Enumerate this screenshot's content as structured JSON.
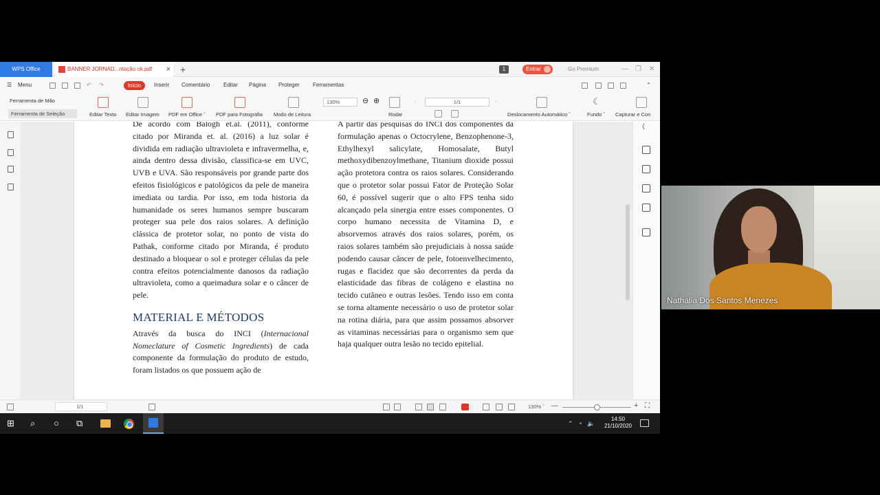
{
  "window": {
    "app_tab": "WPS Office",
    "doc_tab": "BANNER JORNAD...ntação ok.pdf",
    "tab_count": "1",
    "login": "Entrar",
    "premium": "Go Premium"
  },
  "menu": {
    "menu": "Menu",
    "items": [
      "Início",
      "Inserir",
      "Comentário",
      "Editar",
      "Página",
      "Proteger",
      "Ferramentas"
    ]
  },
  "ribbon": {
    "hand_tool": "Ferramenta de Mão",
    "select_tool": "Ferramenta de Seleção",
    "edit_text": "Editar Texto",
    "edit_image": "Editar Imagem",
    "pdf_office": "PDF em Office ˇ",
    "pdf_photo": "PDF para Fotografia",
    "read_mode": "Modo de Leitura",
    "zoom": "130%",
    "rotate": "Rodar",
    "page": "1/1",
    "auto_scroll": "Deslocamento Automático ˇ",
    "background": "Fundo ˇ",
    "capture": "Capturar e Con"
  },
  "document": {
    "left_para1": "De acordo com Balogh et.al. (2011), conforme citado por Miranda et. al. (2016) a luz solar é dividida em radiação ultravioleta e infravermelha, e, ainda dentro dessa divisão, classifica-se em UVC, UVB e UVA. São responsáveis por grande parte dos efeitos fisiológicos e patológicos da pele de maneira imediata ou tardia. Por isso, em toda historia da humanidade os seres humanos sempre buscaram proteger sua pele dos raios solares. A definição clássica de protetor solar, no ponto de vista do Pathak, conforme citado por Miranda, é produto destinado a bloquear o sol e proteger células da pele contra efeitos potencialmente danosos da radiação ultravioleta, como a queimadura solar e o câncer de pele.",
    "heading": "MATERIAL E MÉTODOS",
    "left_para2_a": "Através da busca do INCI (",
    "left_para2_italic": "Internacional Nomeclature of Cosmetic Ingredients",
    "left_para2_b": ") de cada componente da formulação do produto de estudo, foram listados os que possuem ação de",
    "right_para": "A partir das pesquisas do INCI dos componentes da formulação apenas o Octocrylene, Benzophenone-3, Ethylhexyl salicylate, Homosalate, Butyl methoxydibenzoylmethane, Titanium dioxide possui ação protetora contra os raios solares. Considerando que o protetor solar possui Fator de Proteção Solar 60, é possível sugerir que o alto FPS tenha sido alcançado pela sinergia entre esses componentes. O corpo humano necessita de Vitamina D, e absorvemos através dos raios solares, porém, os raios solares também são prejudiciais à nossa saúde podendo causar câncer de pele, fotoenvelhecimento, rugas e flacidez que são decorrentes da perda da elasticidade das fibras de colágeno e elastina no tecido cutâneo e outras lesões. Tendo isso em conta se torna altamente necessário o uso de protetor solar na rotina diária, para que assim possamos absorver as vitaminas necessárias para o organismo sem que haja qualquer outra lesão no tecido epitelial."
  },
  "status": {
    "page": "1/1",
    "zoom": "130% ˇ"
  },
  "taskbar": {
    "time": "14:50",
    "date": "21/10/2020"
  },
  "webcam": {
    "name": "Nathalia Dos Santos Menezes"
  }
}
